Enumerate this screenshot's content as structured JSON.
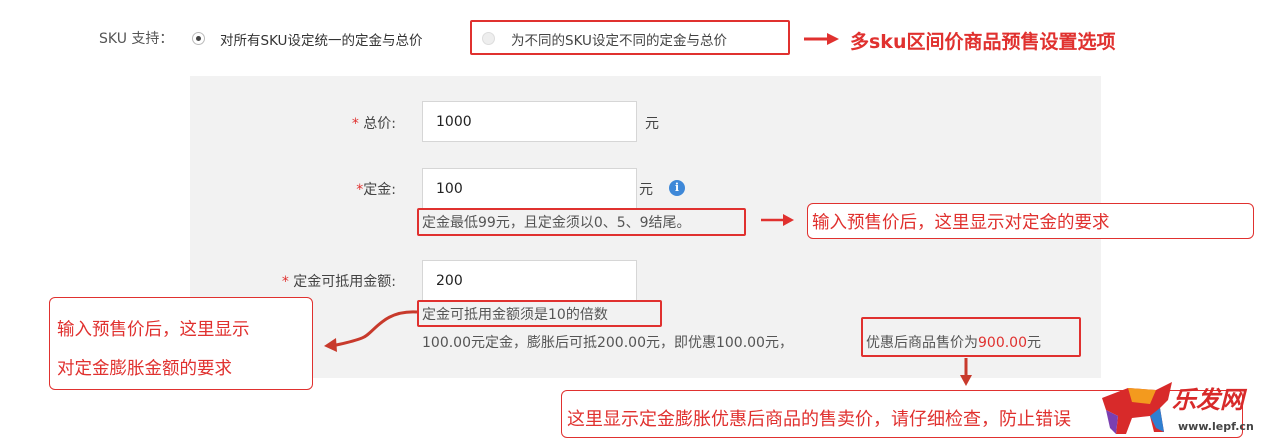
{
  "sku": {
    "label": "SKU 支持：",
    "option_uniform": "对所有SKU设定统一的定金与总价",
    "option_different": "为不同的SKU设定不同的定金与总价",
    "annotation": "多sku区间价商品预售设置选项"
  },
  "form": {
    "total_price": {
      "star": "* ",
      "label": "总价:",
      "value": "1000",
      "unit": "元"
    },
    "deposit": {
      "star": "*",
      "label": "定金:",
      "value": "100",
      "unit": "元",
      "info_icon": "i",
      "hint": "定金最低99元，且定金须以0、5、9结尾。"
    },
    "deductible": {
      "star": "* ",
      "label": "定金可抵用金额:",
      "value": "200",
      "hint": "定金可抵用金额须是10的倍数",
      "summary_prefix": "100.00元定金，膨胀后可抵200.00元，即优惠100.00元，",
      "summary_price_label": "优惠后商品售价为",
      "summary_price_value": "900.00",
      "summary_price_unit": "元"
    }
  },
  "annotations": {
    "deposit_requirement": "输入预售价后，这里显示对定金的要求",
    "expansion_line1": "输入预售价后，这里显示",
    "expansion_line2": "对定金膨胀金额的要求",
    "final_price": "这里显示定金膨胀优惠后商品的售卖价，请仔细检查，",
    "final_price_tail": "防止错误"
  },
  "watermark": {
    "name": "乐发网",
    "url": "www.lepf.cn"
  },
  "colors": {
    "accent_red": "#e0312f",
    "info_blue": "#3e88d8",
    "panel_bg": "#f2f2f2"
  }
}
